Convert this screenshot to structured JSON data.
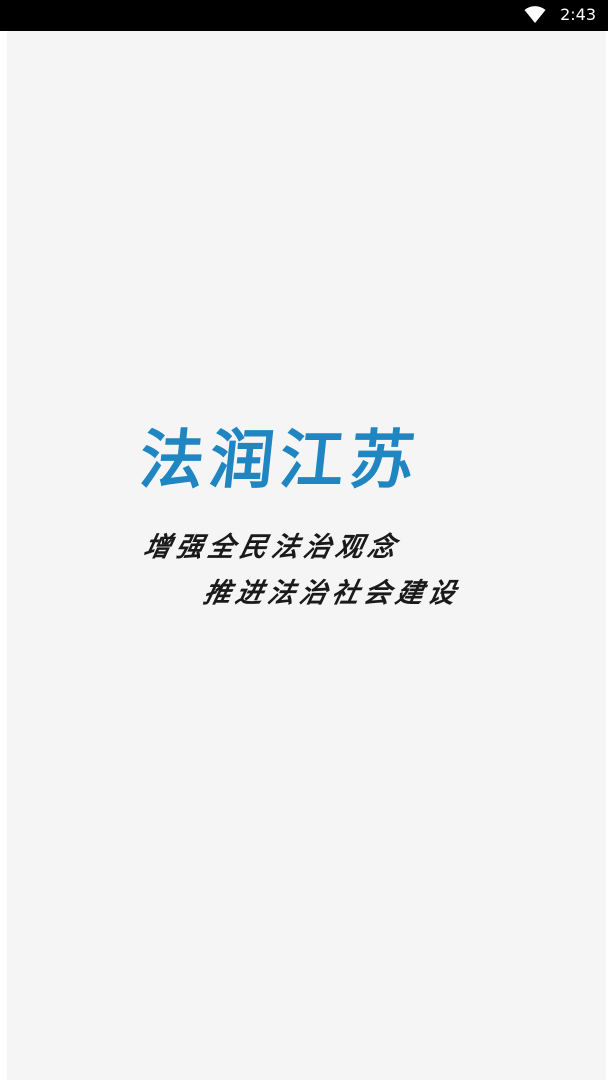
{
  "status_bar": {
    "time": "2:43",
    "wifi_icon": "wifi-full-icon"
  },
  "splash": {
    "app_title": "法润江苏",
    "slogan_line_1": "增强全民法治观念",
    "slogan_line_2": "推进法治社会建设"
  },
  "colors": {
    "status_bar_bg": "#000000",
    "screen_bg": "#f5f5f5",
    "title_color": "#1f86c2",
    "slogan_color": "#1a1a1a"
  }
}
